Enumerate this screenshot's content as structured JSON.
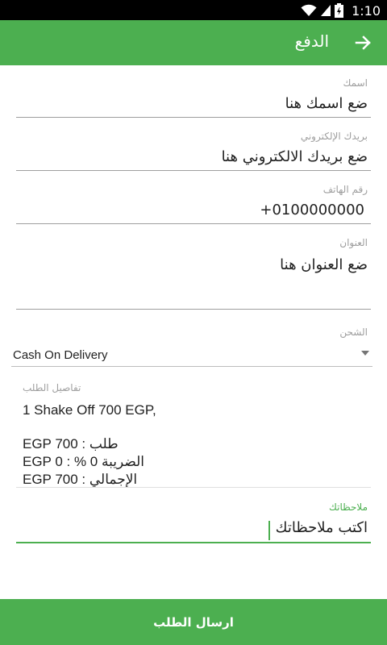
{
  "status_bar": {
    "time": "1:10"
  },
  "app_bar": {
    "title": "الدفع"
  },
  "form": {
    "name": {
      "label": "اسمك",
      "value": "ضع اسمك هنا"
    },
    "email": {
      "label": "بريدك الإلكتروني",
      "value": "ضع بريدك الالكتروني هنا"
    },
    "phone": {
      "label": "رقم الهاتف",
      "value": "+0100000000"
    },
    "address": {
      "label": "العنوان",
      "value": "ضع العنوان هنا"
    },
    "shipping": {
      "label": "الشحن",
      "selected": "Cash On Delivery"
    },
    "details": {
      "label": "تفاصيل الطلب",
      "item_line": "1 Shake Off 700 EGP,",
      "order_line": "EGP 700 : طلب",
      "tax_line": "EGP 0 : % 0 الضريبة",
      "total_line": "EGP 700 : الإجمالي"
    },
    "notes": {
      "label": "ملاحظاتك",
      "value": "اكتب ملاحظاتك"
    }
  },
  "submit": {
    "label": "ارسال الطلب"
  },
  "colors": {
    "accent": "#4caf50",
    "status_bar": "#000000"
  }
}
